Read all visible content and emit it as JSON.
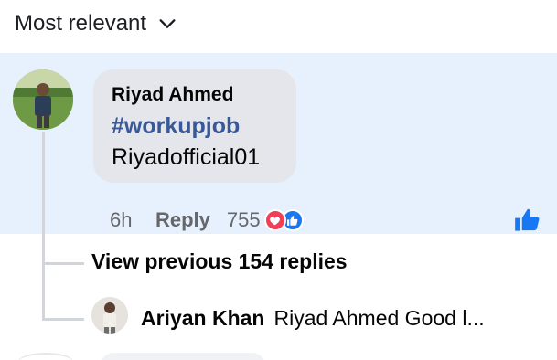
{
  "sort": {
    "label": "Most relevant"
  },
  "comment": {
    "author": "Riyad Ahmed",
    "hashtag": "#workupjob",
    "text": "Riyadofficial01",
    "time": "6h",
    "reply_label": "Reply",
    "reaction_count": "755",
    "reactions": [
      "love-reaction-icon",
      "like-reaction-icon"
    ]
  },
  "replies": {
    "view_previous_label": "View previous 154 replies",
    "latest": {
      "author": "Ariyan Khan",
      "text": "Riyad Ahmed Good l..."
    }
  },
  "colors": {
    "highlight_bg": "#e7f1fd",
    "bubble_bg": "#e4e6eb",
    "hashtag": "#385898",
    "like_blue": "#1877f2",
    "love_red": "#f33e58",
    "muted_text": "#65676b"
  }
}
